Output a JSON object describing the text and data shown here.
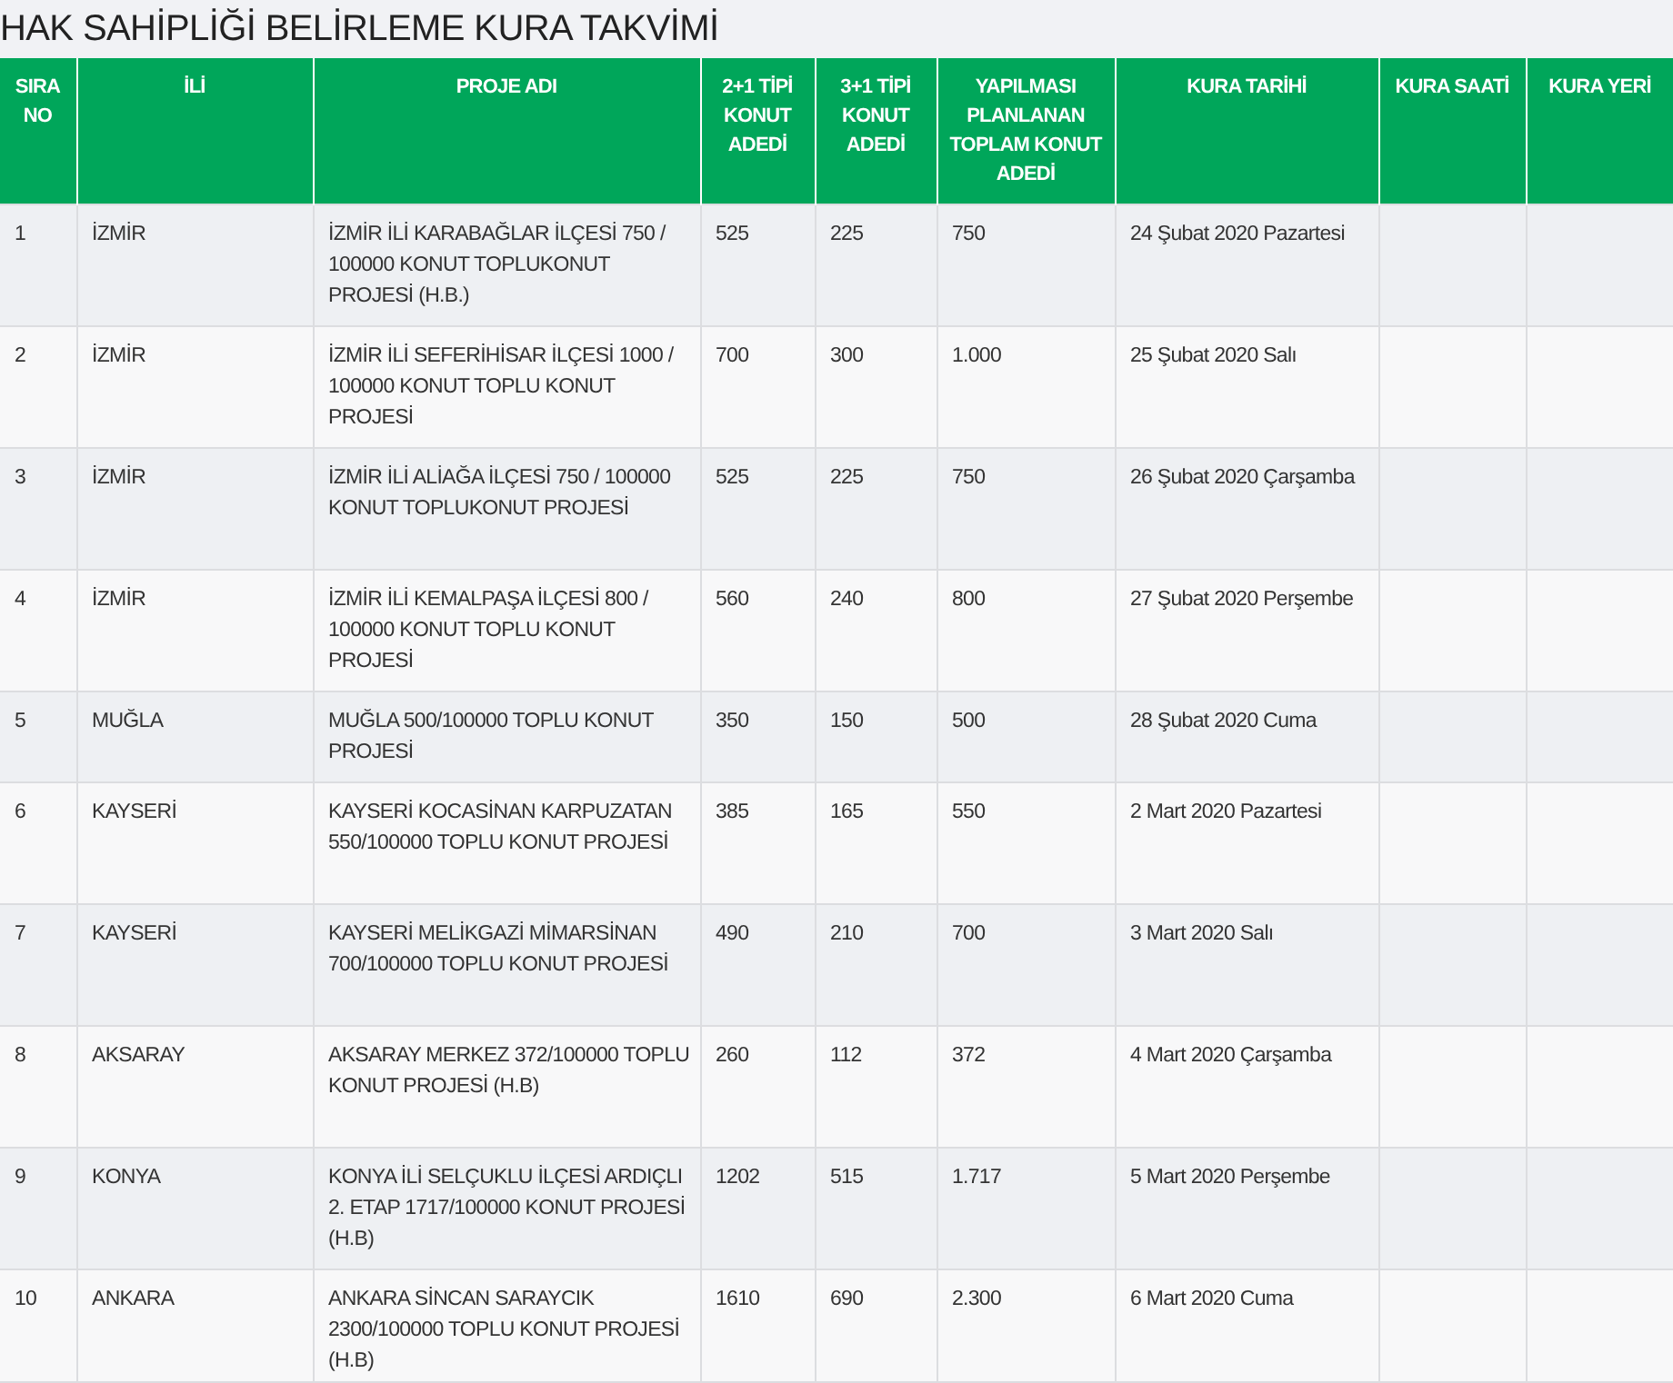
{
  "title": "HAK SAHİPLİĞİ BELİRLEME KURA TAKVİMİ",
  "table": {
    "columns": [
      "SIRA NO",
      "İLİ",
      "PROJE ADI",
      "2+1 TİPİ KONUT ADEDİ",
      "3+1 TİPİ KONUT ADEDİ",
      "YAPILMASI PLANLANAN TOPLAM KONUT ADEDİ",
      "KURA TARİHİ",
      "KURA SAATİ",
      "KURA YERİ"
    ],
    "rows": [
      [
        "1",
        "İZMİR",
        "İZMİR İLİ KARABAĞLAR İLÇESİ 750 / 100000 KONUT TOPLUKONUT PROJESİ (H.B.)",
        "525",
        "225",
        "750",
        "24 Şubat 2020 Pazartesi"
      ],
      [
        "2",
        "İZMİR",
        "İZMİR İLİ SEFERİHİSAR İLÇESİ 1000 / 100000 KONUT TOPLU KONUT PROJESİ",
        "700",
        "300",
        "1.000",
        "25 Şubat 2020 Salı"
      ],
      [
        "3",
        "İZMİR",
        "İZMİR İLİ ALİAĞA İLÇESİ 750 / 100000 KONUT TOPLUKONUT PROJESİ",
        "525",
        "225",
        "750",
        "26 Şubat 2020 Çarşamba"
      ],
      [
        "4",
        "İZMİR",
        "İZMİR İLİ KEMALPAŞA İLÇESİ 800 / 100000 KONUT TOPLU KONUT PROJESİ",
        "560",
        "240",
        "800",
        "27 Şubat 2020 Perşembe"
      ],
      [
        "5",
        "MUĞLA",
        "MUĞLA 500/100000 TOPLU KONUT PROJESİ",
        "350",
        "150",
        "500",
        "28 Şubat 2020 Cuma"
      ],
      [
        "6",
        "KAYSERİ",
        "KAYSERİ KOCASİNAN KARPUZATAN 550/100000 TOPLU KONUT PROJESİ",
        "385",
        "165",
        "550",
        "2 Mart 2020 Pazartesi"
      ],
      [
        "7",
        "KAYSERİ",
        "KAYSERİ MELİKGAZİ MİMARSİNAN 700/100000 TOPLU KONUT PROJESİ",
        "490",
        "210",
        "700",
        "3 Mart 2020 Salı"
      ],
      [
        "8",
        "AKSARAY",
        "AKSARAY MERKEZ 372/100000 TOPLU KONUT PROJESİ (H.B)",
        "260",
        "112",
        "372",
        "4 Mart 2020 Çarşamba"
      ],
      [
        "9",
        "KONYA",
        "KONYA İLİ SELÇUKLU İLÇESİ ARDIÇLI 2. ETAP 1717/100000 KONUT PROJESİ (H.B)",
        "1202",
        "515",
        "1.717",
        "5 Mart 2020 Perşembe"
      ],
      [
        "10",
        "ANKARA",
        "ANKARA SİNCAN SARAYCIK 2300/100000 TOPLU KONUT PROJESİ (H.B)",
        "1610",
        "690",
        "2.300",
        "6 Mart 2020 Cuma"
      ]
    ]
  }
}
